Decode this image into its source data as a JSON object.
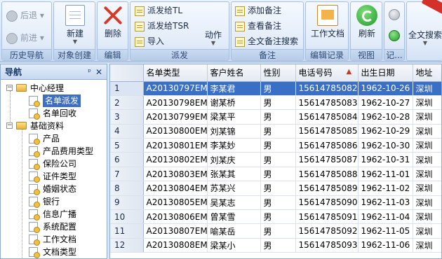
{
  "ribbon": {
    "groups": [
      {
        "label": "历史导航"
      },
      {
        "label": "对象创建"
      },
      {
        "label": "编辑"
      },
      {
        "label": "派发"
      },
      {
        "label": "备注"
      },
      {
        "label": "编辑记录"
      },
      {
        "label": "视图"
      },
      {
        "label": "记..."
      }
    ],
    "back_label": "后退",
    "forward_label": "前进",
    "new_label": "新建",
    "delete_label": "删除",
    "dispatch_tl_label": "派发给TL",
    "dispatch_tsr_label": "派发给TSR",
    "import_label": "导入",
    "action_label": "动作",
    "add_note_label": "添加备注",
    "view_note_label": "查看备注",
    "fulltext_note_search_label": "全文备注搜索",
    "work_doc_label": "工作文档",
    "refresh_label": "刷新",
    "fulltext_search_label": "全文搜索"
  },
  "nav": {
    "title": "导航",
    "pin_glyph": "ᵖ",
    "close_glyph": "✕",
    "tree": [
      {
        "label": "中心经理",
        "level": 0,
        "expanded": true
      },
      {
        "label": "名单派发",
        "level": 1,
        "selected": true
      },
      {
        "label": "名单回收",
        "level": 1
      },
      {
        "label": "基础资料",
        "level": 0,
        "expanded": true
      },
      {
        "label": "产品",
        "level": 1
      },
      {
        "label": "产品费用类型",
        "level": 1
      },
      {
        "label": "保险公司",
        "level": 1
      },
      {
        "label": "证件类型",
        "level": 1
      },
      {
        "label": "婚姻状态",
        "level": 1
      },
      {
        "label": "银行",
        "level": 1
      },
      {
        "label": "信息广播",
        "level": 1
      },
      {
        "label": "系统配置",
        "level": 1
      },
      {
        "label": "工作文档",
        "level": 1
      },
      {
        "label": "文档类型",
        "level": 1
      }
    ]
  },
  "grid": {
    "columns": [
      "名单类型",
      "客户姓名",
      "性别",
      "电话号码",
      "出生日期",
      "地址"
    ],
    "rows": [
      [
        "1",
        "A20130797EM",
        "李某君",
        "男",
        "15614785082",
        "1962-10-26",
        "深圳"
      ],
      [
        "2",
        "A20130798EM",
        "谢某桥",
        "男",
        "15614785083",
        "1962-10-27",
        "深圳"
      ],
      [
        "3",
        "A20130799EM",
        "梁某平",
        "男",
        "15614785084",
        "1962-10-28",
        "深圳"
      ],
      [
        "4",
        "A20130800EM",
        "刘某锦",
        "男",
        "15614785085",
        "1962-10-29",
        "深圳"
      ],
      [
        "5",
        "A20130801EM",
        "李某妙",
        "男",
        "15614785086",
        "1962-10-30",
        "深圳"
      ],
      [
        "6",
        "A20130802EM",
        "刘某庆",
        "男",
        "15614785087",
        "1962-10-31",
        "深圳"
      ],
      [
        "7",
        "A20130803EM",
        "张某其",
        "男",
        "15614785088",
        "1962-11-01",
        "深圳"
      ],
      [
        "8",
        "A20130804EM",
        "苏某兴",
        "男",
        "15614785089",
        "1962-11-02",
        "深圳"
      ],
      [
        "9",
        "A20130805EM",
        "吴某志",
        "男",
        "15614785090",
        "1962-11-03",
        "深圳"
      ],
      [
        "10",
        "A20130806EM",
        "曾某雪",
        "男",
        "15614785091",
        "1962-11-04",
        "深圳"
      ],
      [
        "11",
        "A20130807EM",
        "喻某岳",
        "男",
        "15614785092",
        "1962-11-05",
        "深圳"
      ],
      [
        "12",
        "A20130808EM",
        "梁某小",
        "男",
        "15614785093",
        "1962-11-06",
        "深圳"
      ]
    ],
    "selected_row": 0
  }
}
